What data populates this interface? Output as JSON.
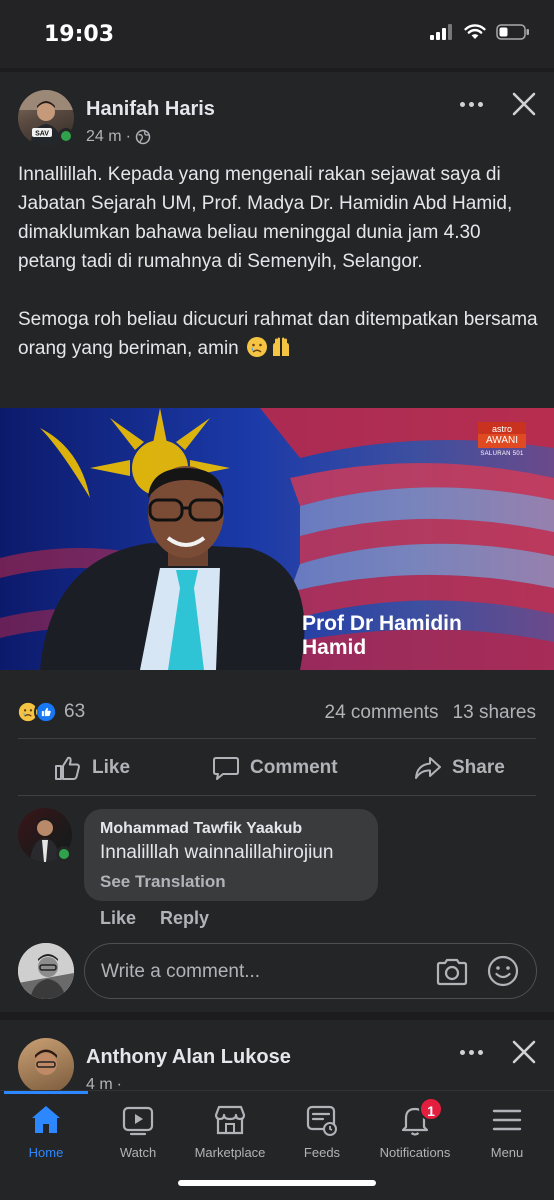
{
  "status": {
    "time": "19:03"
  },
  "post": {
    "author": "Hanifah Haris",
    "avatar_badge": "SAV",
    "time": "24 m",
    "text": "Innallillah. Kepada yang mengenali rakan sejawat saya di Jabatan Sejarah UM, Prof. Madya Dr. Hamidin Abd Hamid, dimaklumkan bahawa beliau meninggal dunia jam 4.30 petang tadi di rumahnya di Semenyih, Selangor.\n\nSemoga roh beliau dicucuri rahmat dan ditempatkan bersama orang yang beriman, amin",
    "image": {
      "caption_line1": "Prof Dr Hamidin",
      "caption_line2": "Hamid",
      "brand_top": "astro",
      "brand_main": "AWANI",
      "brand_sub": "SALURAN 501"
    },
    "reaction_count": "63",
    "comments": "24 comments",
    "shares": "13 shares",
    "actions": {
      "like": "Like",
      "comment": "Comment",
      "share": "Share"
    }
  },
  "comment": {
    "author": "Mohammad Tawfik Yaakub",
    "text": "Innalilllah wainnalillahirojiun",
    "see_translation": "See Translation",
    "like": "Like",
    "reply": "Reply"
  },
  "write_comment": {
    "placeholder": "Write a comment..."
  },
  "next_post": {
    "author": "Anthony Alan Lukose",
    "time": "4 m"
  },
  "nav": {
    "items": [
      {
        "label": "Home",
        "icon": "home-icon"
      },
      {
        "label": "Watch",
        "icon": "watch-icon"
      },
      {
        "label": "Marketplace",
        "icon": "marketplace-icon"
      },
      {
        "label": "Feeds",
        "icon": "feeds-icon"
      },
      {
        "label": "Notifications",
        "icon": "bell-icon"
      },
      {
        "label": "Menu",
        "icon": "menu-icon"
      }
    ],
    "notification_badge": "1"
  },
  "colors": {
    "accent": "#2d88ff",
    "background": "#242526",
    "online": "#31a24c",
    "badge": "#e41e3f"
  }
}
